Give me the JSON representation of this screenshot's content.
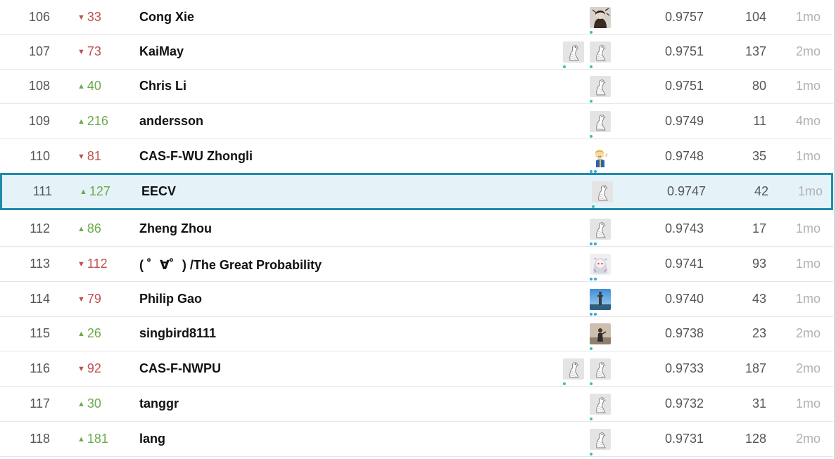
{
  "leaderboard": {
    "rows": [
      {
        "rank": "106",
        "direction": "down",
        "delta": "33",
        "name": "Cong Xie",
        "score": "0.9757",
        "entries": "104",
        "last": "1mo",
        "avatars": [
          "portrait-icon"
        ],
        "tier": "novice"
      },
      {
        "rank": "107",
        "direction": "down",
        "delta": "73",
        "name": "KaiMay",
        "score": "0.9751",
        "entries": "137",
        "last": "2mo",
        "avatars": [
          "goose-icon",
          "goose-icon"
        ],
        "tier": "novice"
      },
      {
        "rank": "108",
        "direction": "up",
        "delta": "40",
        "name": "Chris Li",
        "score": "0.9751",
        "entries": "80",
        "last": "1mo",
        "avatars": [
          "goose-icon"
        ],
        "tier": "novice"
      },
      {
        "rank": "109",
        "direction": "up",
        "delta": "216",
        "name": "andersson",
        "score": "0.9749",
        "entries": "11",
        "last": "4mo",
        "avatars": [
          "goose-icon"
        ],
        "tier": "novice"
      },
      {
        "rank": "110",
        "direction": "down",
        "delta": "81",
        "name": "CAS-F-WU Zhongli",
        "score": "0.9748",
        "entries": "35",
        "last": "1mo",
        "avatars": [
          "vault-boy-icon"
        ],
        "tier": "contributor"
      },
      {
        "rank": "111",
        "direction": "up",
        "delta": "127",
        "name": "EECV",
        "score": "0.9747",
        "entries": "42",
        "last": "1mo",
        "avatars": [
          "goose-icon"
        ],
        "tier": "novice",
        "highlight": true
      },
      {
        "rank": "112",
        "direction": "up",
        "delta": "86",
        "name": "Zheng Zhou",
        "score": "0.9743",
        "entries": "17",
        "last": "1mo",
        "avatars": [
          "goose-icon"
        ],
        "tier": "contributor"
      },
      {
        "rank": "113",
        "direction": "down",
        "delta": "112",
        "name": "( ゜∀゜) /The Great Probability",
        "score": "0.9741",
        "entries": "93",
        "last": "1mo",
        "avatars": [
          "anime-icon"
        ],
        "tier": "contributor"
      },
      {
        "rank": "114",
        "direction": "down",
        "delta": "79",
        "name": "Philip Gao",
        "score": "0.9740",
        "entries": "43",
        "last": "1mo",
        "avatars": [
          "tower-photo-icon"
        ],
        "tier": "contributor"
      },
      {
        "rank": "115",
        "direction": "up",
        "delta": "26",
        "name": "singbird8111",
        "score": "0.9738",
        "entries": "23",
        "last": "2mo",
        "avatars": [
          "person-photo-icon"
        ],
        "tier": "novice"
      },
      {
        "rank": "116",
        "direction": "down",
        "delta": "92",
        "name": "CAS-F-NWPU",
        "score": "0.9733",
        "entries": "187",
        "last": "2mo",
        "avatars": [
          "goose-icon",
          "goose-icon"
        ],
        "tier": "novice"
      },
      {
        "rank": "117",
        "direction": "up",
        "delta": "30",
        "name": "tanggr",
        "score": "0.9732",
        "entries": "31",
        "last": "1mo",
        "avatars": [
          "goose-icon"
        ],
        "tier": "novice"
      },
      {
        "rank": "118",
        "direction": "up",
        "delta": "181",
        "name": "lang",
        "score": "0.9731",
        "entries": "128",
        "last": "2mo",
        "avatars": [
          "goose-icon"
        ],
        "tier": "novice"
      }
    ]
  },
  "colors": {
    "up": "#6bab4c",
    "down": "#c0504e",
    "highlight_border": "#1f8cad",
    "highlight_bg": "#e5f3f9",
    "tier_novice": "#3dbfa7",
    "tier_contributor": "#2ba8e6"
  }
}
